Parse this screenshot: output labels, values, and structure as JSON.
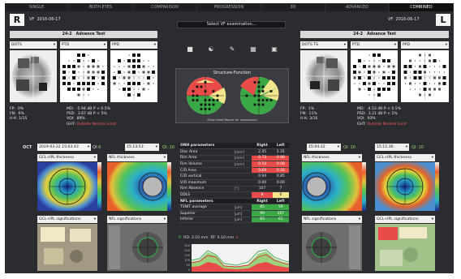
{
  "tabs": [
    "SINGLE",
    "BOTH EYES",
    "COMPARISON",
    "PROGRESSION",
    "3D",
    "ADVANCED",
    "COMBINED"
  ],
  "left_eye": {
    "letter": "R",
    "vf_label": "VF",
    "vf_date": "2016-06-17",
    "test": "24-2",
    "test_name": "Advance Test",
    "dd": [
      "DOTS",
      "PTD",
      "PPD"
    ],
    "stats": {
      "fp": "FP:  0%",
      "fn": "FN:  6%",
      "hk": "H-K: 1/15",
      "md": "MD:  -5.94 dB P < 0.5%",
      "psd": "PSD:  3.67 dB P < 5%",
      "vqi": "VQI:  89%",
      "ght_k": "GHT: ",
      "ght_v": "Outside Normal Limit"
    }
  },
  "right_eye": {
    "letter": "L",
    "vf_label": "VF",
    "vf_date": "2016-06-17",
    "test": "24-2",
    "test_name": "Advance Test",
    "dd": [
      "DOTS  TS",
      "PTD",
      "PPD"
    ],
    "stats": {
      "fp": "FP:  1%",
      "fn": "FN:  11%",
      "hk": "H-K: 3/16",
      "md": "MD:  -4.53 dB P < 0.5%",
      "psd": "PSD:  3.21 dB P < 1%",
      "vqi": "VQI:  93%",
      "ght_k": "GHT: ",
      "ght_v": "Outside Normal Limit"
    }
  },
  "center": {
    "select_button": "Select VF examination...",
    "structure_title": "Structure-Function",
    "structure_caption": "Show Hood Report for comparison"
  },
  "oct": {
    "label": "OCT",
    "date": "2019-03-22 15:03:43",
    "ql_label": "Ql:",
    "ql": "9",
    "left_scan": "15:13:53",
    "left_ql": "Ql: 10",
    "right_scan_a": "15:04:32",
    "right_ql_a": "Ql: 10",
    "right_scan_b": "15:11:36",
    "right_ql_b": "Ql: 10",
    "maps": [
      "GCL+IPL thickness",
      "NFL thickness",
      "NFL thickness",
      "GCL+IPL thickness"
    ],
    "sigs": [
      "GCL+IPL significations",
      "NFL significations",
      "NFL significations",
      "GCL+IPL significations"
    ]
  },
  "onh": {
    "header": [
      "ONH parameters",
      "Right",
      "Left"
    ],
    "rows": [
      {
        "name": "Disc Area",
        "unit": "[mm²]",
        "r": "2.35",
        "l": "2.31",
        "rc": "",
        "lc": ""
      },
      {
        "name": "Rim Area",
        "unit": "[mm²]",
        "r": "0.73",
        "l": "0.98",
        "rc": "red",
        "lc": "red"
      },
      {
        "name": "Rim Volume",
        "unit": "[mm³]",
        "r": "0.10",
        "l": "0.08",
        "rc": "red",
        "lc": "red"
      },
      {
        "name": "C/D Area",
        "unit": "",
        "r": "0.69",
        "l": "0.58",
        "rc": "red",
        "lc": "red"
      },
      {
        "name": "C/D vertical",
        "unit": "",
        "r": "0.94",
        "l": "0.85",
        "rc": "",
        "lc": ""
      },
      {
        "name": "V/D maximum",
        "unit": "",
        "r": "0.00",
        "l": "0.00",
        "rc": "",
        "lc": ""
      },
      {
        "name": "Rim Absence",
        "unit": "[°]",
        "r": "107",
        "l": "7",
        "rc": "",
        "lc": ""
      },
      {
        "name": "DDLS",
        "unit": "",
        "r": "8",
        "l": "6",
        "rc": "red",
        "lc": "yel"
      }
    ],
    "nfl_header": [
      "NFL parameters",
      "Right",
      "Left"
    ],
    "nfl_rows": [
      {
        "name": "TSNIT average",
        "unit": "[µm]",
        "r": "85",
        "l": "59",
        "rc": "grn",
        "lc": "grn"
      },
      {
        "name": "Superior",
        "unit": "[µm]",
        "r": "99",
        "l": "107",
        "rc": "grn",
        "lc": "grn"
      },
      {
        "name": "Inferior",
        "unit": "[µm]",
        "r": "83",
        "l": "61",
        "rc": "grn",
        "lc": "grn"
      }
    ]
  },
  "profile": {
    "r_label": "R",
    "rd": "RD: 3.10 mm",
    "rt": "RT: 0.10 mm",
    "l_label": "L",
    "y_ticks": [
      "250",
      "200",
      "150",
      "100",
      "50",
      "0"
    ],
    "y_unit": "[µm]"
  }
}
